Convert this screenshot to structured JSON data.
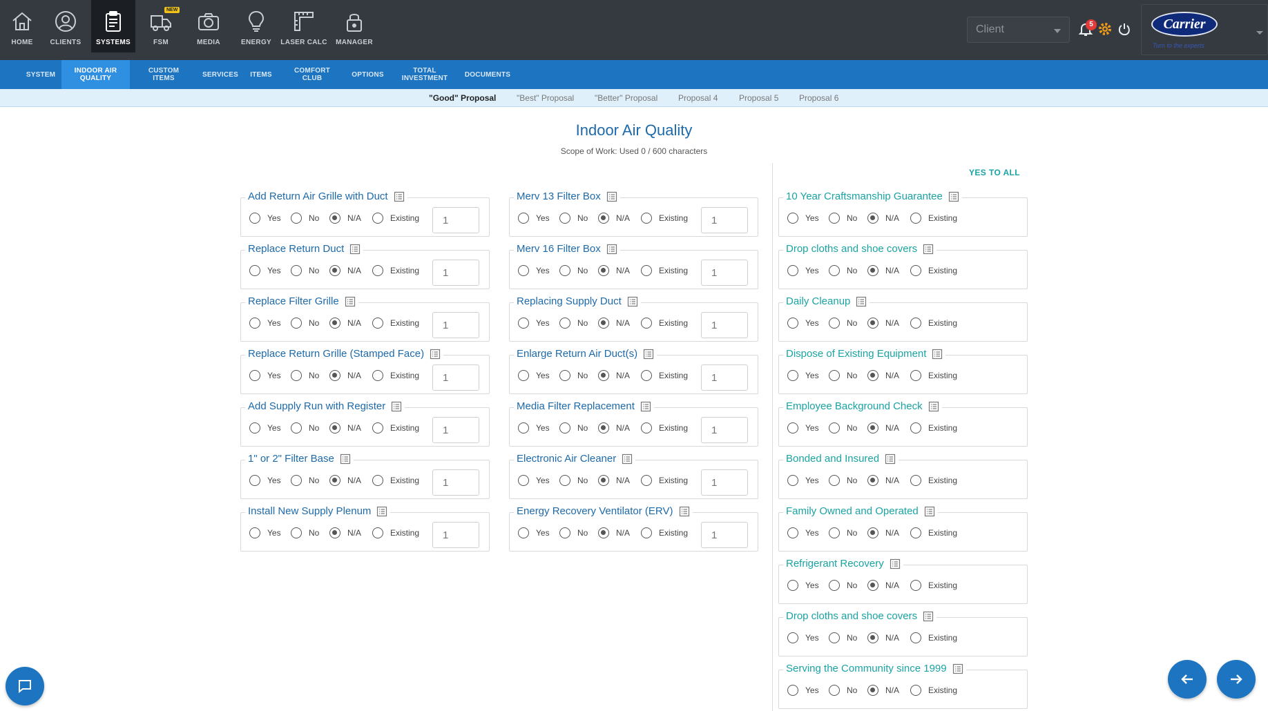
{
  "nav": {
    "items": [
      {
        "label": "HOME",
        "icon": "home-icon"
      },
      {
        "label": "CLIENTS",
        "icon": "user-icon"
      },
      {
        "label": "SYSTEMS",
        "icon": "clipboard-icon",
        "active": true
      },
      {
        "label": "FSM",
        "icon": "truck-icon",
        "badge": "NEW"
      },
      {
        "label": "MEDIA",
        "icon": "camera-icon"
      },
      {
        "label": "ENERGY",
        "icon": "lightbulb-icon"
      },
      {
        "label": "LASER CALC",
        "icon": "ruler-icon"
      },
      {
        "label": "MANAGER",
        "icon": "lock-icon"
      }
    ]
  },
  "header": {
    "client_placeholder": "Client",
    "notification_count": "5",
    "brand_name": "Carrier",
    "brand_tagline": "Turn to the experts"
  },
  "subnav": {
    "items": [
      "SYSTEM",
      "INDOOR AIR QUALITY",
      "CUSTOM ITEMS",
      "SERVICES",
      "ITEMS",
      "COMFORT CLUB",
      "OPTIONS",
      "TOTAL INVESTMENT",
      "DOCUMENTS"
    ],
    "active_index": 1
  },
  "proposals": {
    "items": [
      "\"Good\" Proposal",
      "\"Best\" Proposal",
      "\"Better\" Proposal",
      "Proposal 4",
      "Proposal 5",
      "Proposal 6"
    ],
    "active_index": 0
  },
  "page": {
    "title": "Indoor Air Quality",
    "subtitle": "Scope of Work: Used 0 / 600 characters",
    "yes_to_all": "YES TO ALL"
  },
  "radio_labels": {
    "yes": "Yes",
    "no": "No",
    "na": "N/A",
    "existing": "Existing"
  },
  "colors": {
    "primary": "#1d74c0",
    "heading": "#1d6aab",
    "teal": "#1aa3a3",
    "topbar": "#343a40"
  },
  "columns": {
    "left": [
      {
        "title": "Add Return Air Grille with Duct",
        "selected": "na",
        "qty": "1"
      },
      {
        "title": "Replace Return Duct",
        "selected": "na",
        "qty": "1"
      },
      {
        "title": "Replace Filter Grille",
        "selected": "na",
        "qty": "1"
      },
      {
        "title": "Replace Return Grille (Stamped Face)",
        "selected": "na",
        "qty": "1"
      },
      {
        "title": "Add Supply Run with Register",
        "selected": "na",
        "qty": "1"
      },
      {
        "title": "1\" or 2\" Filter Base",
        "selected": "na",
        "qty": "1"
      },
      {
        "title": "Install New Supply Plenum",
        "selected": "na",
        "qty": "1"
      }
    ],
    "middle": [
      {
        "title": "Merv 13 Filter Box",
        "selected": "na",
        "qty": "1"
      },
      {
        "title": "Merv 16 Filter Box",
        "selected": "na",
        "qty": "1"
      },
      {
        "title": "Replacing Supply Duct",
        "selected": "na",
        "qty": "1"
      },
      {
        "title": "Enlarge Return Air Duct(s)",
        "selected": "na",
        "qty": "1"
      },
      {
        "title": "Media Filter Replacement",
        "selected": "na",
        "qty": "1"
      },
      {
        "title": "Electronic Air Cleaner",
        "selected": "na",
        "qty": "1"
      },
      {
        "title": "Energy Recovery Ventilator (ERV)",
        "selected": "na",
        "qty": "1"
      }
    ],
    "right": [
      {
        "title": "10 Year Craftsmanship Guarantee",
        "selected": "na"
      },
      {
        "title": "Drop cloths and shoe covers",
        "selected": "na"
      },
      {
        "title": "Daily Cleanup",
        "selected": "na"
      },
      {
        "title": "Dispose of Existing Equipment",
        "selected": "na"
      },
      {
        "title": "Employee Background Check",
        "selected": "na"
      },
      {
        "title": "Bonded and Insured",
        "selected": "na"
      },
      {
        "title": "Family Owned and Operated",
        "selected": "na"
      },
      {
        "title": "Refrigerant Recovery",
        "selected": "na"
      },
      {
        "title": "Drop cloths and shoe covers",
        "selected": "na"
      },
      {
        "title": "Serving the Community since 1999",
        "selected": "na"
      }
    ]
  }
}
